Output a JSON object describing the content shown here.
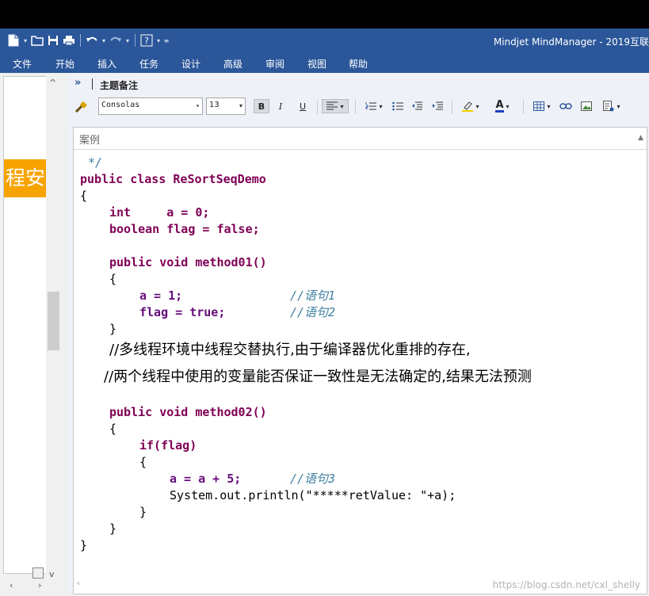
{
  "window": {
    "title": "Mindjet MindManager - 2019互联"
  },
  "menu": [
    "文件",
    "开始",
    "插入",
    "任务",
    "设计",
    "高级",
    "审阅",
    "视图",
    "帮助"
  ],
  "left_panel": {
    "topic_text": "程安"
  },
  "notes_panel": {
    "title": "主题备注",
    "collapse_glyph": "»"
  },
  "format_bar": {
    "font": "Consolas",
    "size": "13",
    "bold": "B",
    "italic": "I",
    "underline": "U",
    "font_color_glyph": "A"
  },
  "editor": {
    "placeholder": "案例",
    "lines": [
      "*/",
      "public class ReSortSeqDemo",
      "{",
      "int     a = 0;",
      "boolean flag = false;",
      "public void method01()",
      "{",
      "a = 1;",
      "//语句1",
      "flag = true;",
      "//语句2",
      "}",
      "//多线程环境中线程交替执行,由于编译器优化重排的存在,",
      "//两个线程中使用的变量能否保证一致性是无法确定的,结果无法预测",
      "public void method02()",
      "{",
      "if(flag)",
      "{",
      "a = a + 5;",
      "//语句3",
      "System.out.println(\"*****retValue: \"+a);",
      "}",
      "}",
      "}"
    ]
  },
  "watermark": "https://blog.csdn.net/cxl_shelly"
}
